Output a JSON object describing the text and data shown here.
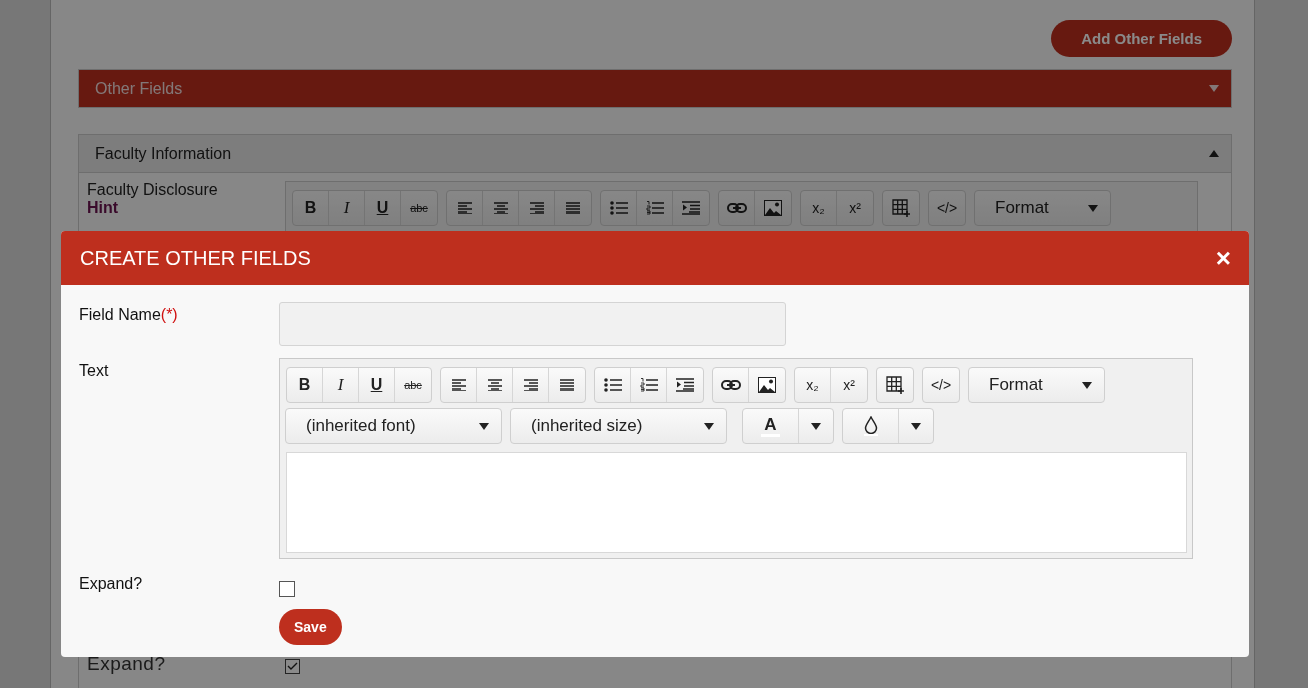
{
  "page": {
    "add_button": "Add Other Fields",
    "sections": [
      {
        "kind": "primary",
        "title": "Other Fields",
        "expanded": false
      },
      {
        "kind": "default",
        "title": "Faculty Information",
        "expanded": true
      }
    ],
    "faculty": {
      "label": "Faculty Disclosure",
      "hint": "Hint",
      "toolbar": {
        "groups": [
          [
            {
              "kind": "bold",
              "label": "B"
            },
            {
              "kind": "italic",
              "label": "I"
            },
            {
              "kind": "underline",
              "label": "U"
            },
            {
              "kind": "strike",
              "label": "abc"
            }
          ],
          [
            {
              "kind": "align-left"
            },
            {
              "kind": "align-center"
            },
            {
              "kind": "align-right"
            },
            {
              "kind": "justify"
            }
          ],
          [
            {
              "kind": "bullet-list"
            },
            {
              "kind": "numbered-list"
            },
            {
              "kind": "indent"
            }
          ],
          [
            {
              "kind": "link"
            },
            {
              "kind": "image"
            }
          ],
          [
            {
              "kind": "subscript",
              "label": "x₂"
            },
            {
              "kind": "superscript",
              "label": "x²"
            }
          ],
          [
            {
              "kind": "table"
            }
          ],
          [
            {
              "kind": "code",
              "label": "</>"
            }
          ]
        ],
        "format": "Format"
      }
    },
    "expand": {
      "label": "Expand?",
      "checked": true
    }
  },
  "dialog": {
    "title": "CREATE OTHER FIELDS",
    "close": "×",
    "fields": [
      {
        "kind": "input",
        "label": "Field Name",
        "required": "(*)"
      },
      {
        "kind": "editor",
        "label": "Text",
        "font": "(inherited font)",
        "size": "(inherited size)",
        "color_label": "A",
        "toolbar": {
          "groups": [
            [
              {
                "kind": "bold",
                "label": "B"
              },
              {
                "kind": "italic",
                "label": "I"
              },
              {
                "kind": "underline",
                "label": "U"
              },
              {
                "kind": "strike",
                "label": "abc"
              }
            ],
            [
              {
                "kind": "align-left"
              },
              {
                "kind": "align-center"
              },
              {
                "kind": "align-right"
              },
              {
                "kind": "justify"
              }
            ],
            [
              {
                "kind": "bullet-list"
              },
              {
                "kind": "numbered-list"
              },
              {
                "kind": "indent"
              }
            ],
            [
              {
                "kind": "link"
              },
              {
                "kind": "image"
              }
            ],
            [
              {
                "kind": "subscript",
                "label": "x₂"
              },
              {
                "kind": "superscript",
                "label": "x²"
              }
            ],
            [
              {
                "kind": "table"
              }
            ],
            [
              {
                "kind": "code",
                "label": "</>"
              }
            ]
          ],
          "format": "Format"
        }
      },
      {
        "kind": "checkbox",
        "label": "Expand?",
        "checked": false
      }
    ],
    "save": "Save"
  }
}
